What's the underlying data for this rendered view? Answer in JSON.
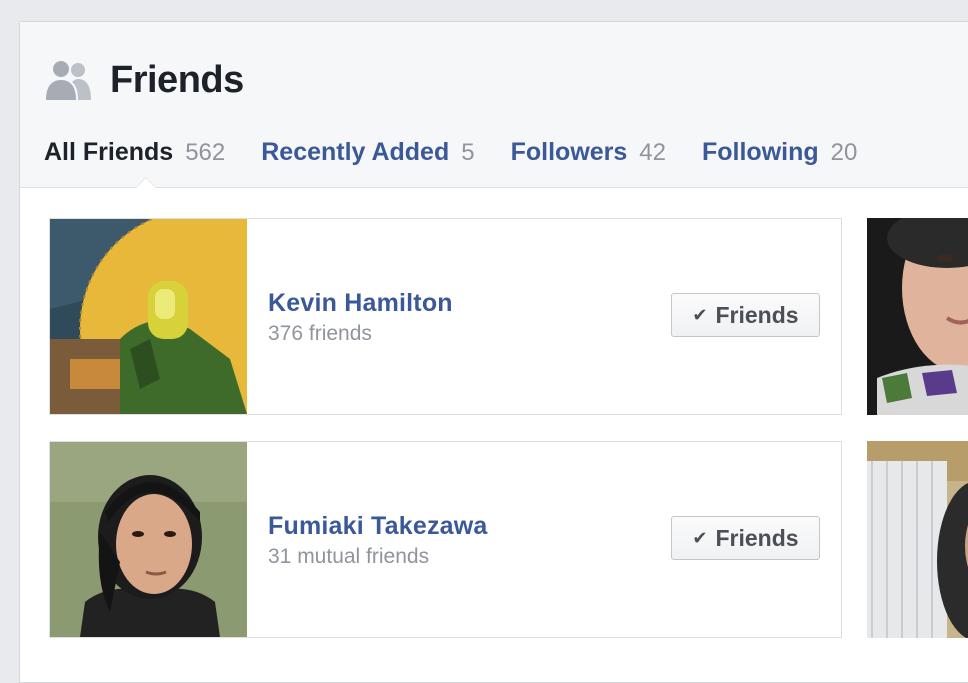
{
  "header": {
    "title": "Friends",
    "icon": "friends-silhouette-icon"
  },
  "tabs": [
    {
      "label": "All Friends",
      "count": "562",
      "active": true
    },
    {
      "label": "Recently Added",
      "count": "5",
      "active": false
    },
    {
      "label": "Followers",
      "count": "42",
      "active": false
    },
    {
      "label": "Following",
      "count": "20",
      "active": false
    }
  ],
  "friends": [
    {
      "name": "Kevin Hamilton",
      "subtitle": "376 friends",
      "button_label": "Friends",
      "button_icon": "checkmark-icon"
    },
    {
      "name": "Fumiaki Takezawa",
      "subtitle": "31 mutual friends",
      "button_label": "Friends",
      "button_icon": "checkmark-icon"
    }
  ],
  "colors": {
    "link_blue": "#3b5998",
    "dark_text": "#1d2129",
    "muted_text": "#90949c",
    "header_bg": "#f6f7f9",
    "page_bg": "#e9eaed"
  }
}
